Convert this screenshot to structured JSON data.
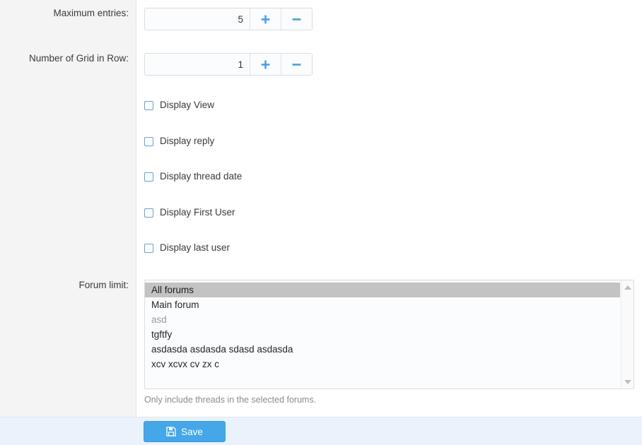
{
  "form": {
    "fields": [
      {
        "label": "Maximum entries:",
        "value": "5",
        "increase_label": "+",
        "decrease_label": "−"
      },
      {
        "label": "Number of Grid in Row:",
        "value": "1",
        "increase_label": "+",
        "decrease_label": "−"
      }
    ],
    "checkboxes": [
      {
        "label": "Display View",
        "checked": false
      },
      {
        "label": "Display reply",
        "checked": false
      },
      {
        "label": "Display thread date",
        "checked": false
      },
      {
        "label": "Display First User",
        "checked": false
      },
      {
        "label": "Display last user",
        "checked": false
      }
    ],
    "forum_limit": {
      "label": "Forum limit:",
      "options": [
        {
          "text": "All forums",
          "selected": true,
          "muted": false
        },
        {
          "text": "Main forum",
          "selected": false,
          "muted": false
        },
        {
          "text": "asd",
          "selected": false,
          "muted": true
        },
        {
          "text": "tgftfy",
          "selected": false,
          "muted": false
        },
        {
          "text": "asdasda asdasda sdasd asdasda",
          "selected": false,
          "muted": false
        },
        {
          "text": "xcv xcvx cv zx c",
          "selected": false,
          "muted": false
        }
      ],
      "help_text": "Only include threads in the selected forums."
    }
  },
  "footer": {
    "save_label": "Save"
  },
  "colors": {
    "accent": "#45a7e8",
    "checkbox_border": "#63a0d8",
    "stepper_glyph": "#4a9fe0",
    "selection": "#c3c3c3",
    "label_gutter": "#f4f4f4",
    "footer_bg": "#eaf3fc"
  }
}
